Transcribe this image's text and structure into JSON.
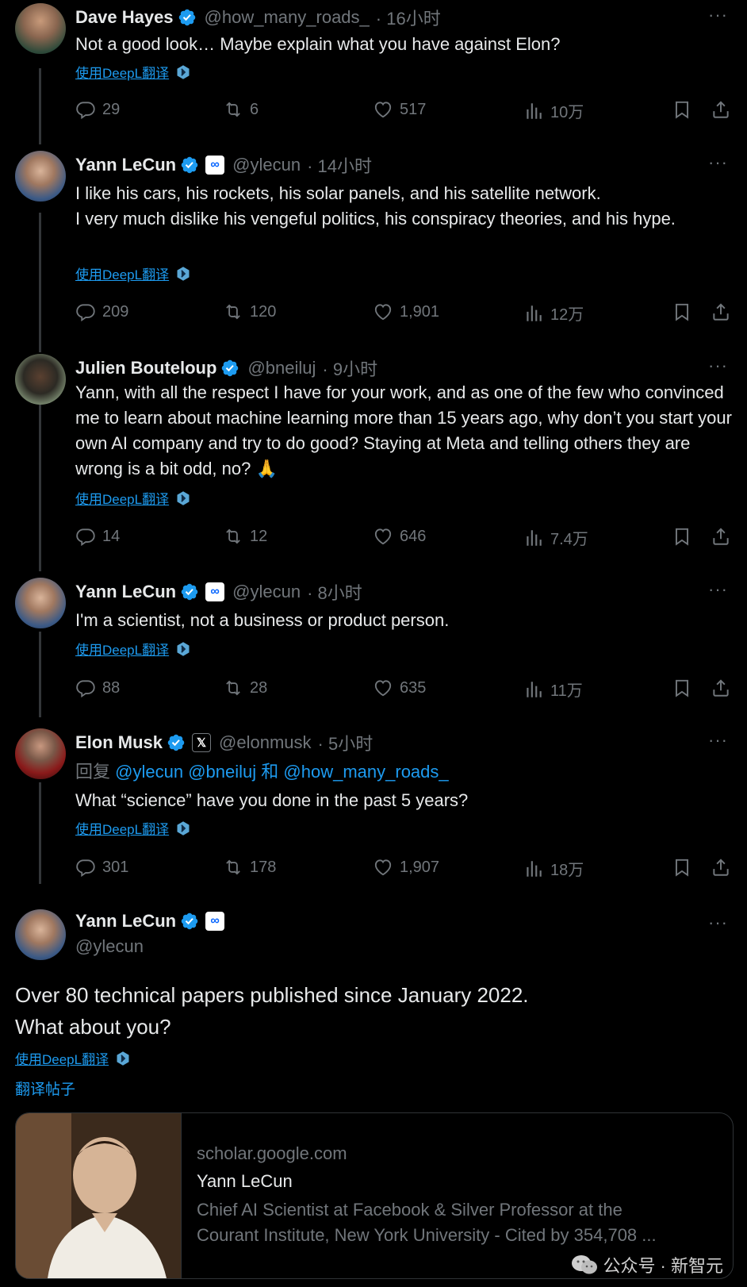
{
  "tweets": [
    {
      "name": "Dave Hayes",
      "handle": "@how_many_roads_",
      "time": "· 16小时",
      "text": "Not a good look… Maybe explain what you have against Elon?",
      "translate": "使用DeepL翻译",
      "replies": "29",
      "retweets": "6",
      "likes": "517",
      "views": "10万",
      "more": "···"
    },
    {
      "name": "Yann LeCun",
      "handle": "@ylecun",
      "time": "· 14小时",
      "text1": "I like his cars, his rockets, his solar panels, and his satellite network.",
      "text2": "I very much dislike his vengeful politics, his conspiracy theories, and his hype.",
      "translate": "使用DeepL翻译",
      "replies": "209",
      "retweets": "120",
      "likes": "1,901",
      "views": "12万",
      "more": "···"
    },
    {
      "name": "Julien Bouteloup",
      "handle": "@bneiluj",
      "time": "· 9小时",
      "text": "Yann, with all the respect I have for your work, and as one of the few who convinced me to learn about machine learning more than 15 years ago, why don’t you start your own AI company and try to do good? Staying at Meta and telling others they are wrong is a bit odd, no? 🙏",
      "translate": "使用DeepL翻译",
      "replies": "14",
      "retweets": "12",
      "likes": "646",
      "views": "7.4万",
      "more": "···"
    },
    {
      "name": "Yann LeCun",
      "handle": "@ylecun",
      "time": "· 8小时",
      "text": "I'm a scientist, not a business or product person.",
      "translate": "使用DeepL翻译",
      "replies": "88",
      "retweets": "28",
      "likes": "635",
      "views": "11万",
      "more": "···"
    },
    {
      "name": "Elon Musk",
      "handle": "@elonmusk",
      "time": "· 5小时",
      "reply_prefix": "回复",
      "reply_m1": "@ylecun",
      "reply_m2": "@bneiluj",
      "reply_and": "和",
      "reply_m3": "@how_many_roads_",
      "text": "What “science” have you done in the past 5 years?",
      "translate": "使用DeepL翻译",
      "replies": "301",
      "retweets": "178",
      "likes": "1,907",
      "views": "18万",
      "more": "···"
    }
  ],
  "main": {
    "name": "Yann LeCun",
    "handle": "@ylecun",
    "text1": "Over 80 technical papers published since January 2022.",
    "text2": "What about you?",
    "translate": "使用DeepL翻译",
    "translate_post": "翻译帖子",
    "more": "···"
  },
  "card": {
    "domain": "scholar.google.com",
    "title": "Yann LeCun",
    "desc1": "Chief AI Scientist at Facebook & Silver Professor at the",
    "desc2": "Courant Institute, New York University - Cited by 354,708 ..."
  },
  "affiliates": {
    "meta": "∞",
    "x": "𝕏"
  },
  "watermark": "公众号 · 新智元",
  "colors": {
    "accent": "#1d9bf0",
    "muted": "#71767b",
    "text": "#e7e9ea",
    "background": "#000000"
  }
}
